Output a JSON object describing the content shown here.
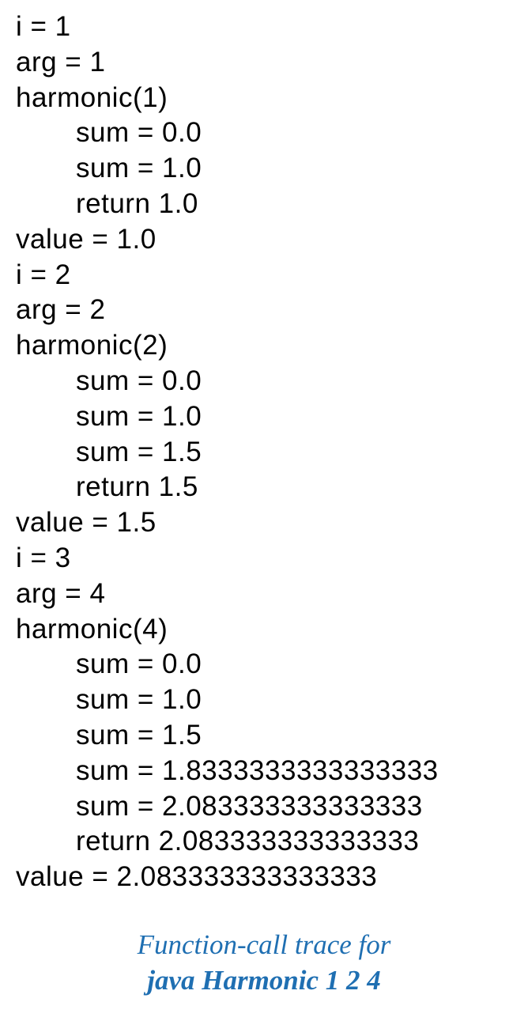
{
  "trace_lines": [
    {
      "text": "i = 1",
      "indent": false
    },
    {
      "text": "arg = 1",
      "indent": false
    },
    {
      "text": "harmonic(1)",
      "indent": false
    },
    {
      "text": "sum = 0.0",
      "indent": true
    },
    {
      "text": "sum = 1.0",
      "indent": true
    },
    {
      "text": "return 1.0",
      "indent": true
    },
    {
      "text": "value = 1.0",
      "indent": false
    },
    {
      "text": "i = 2",
      "indent": false
    },
    {
      "text": "arg = 2",
      "indent": false
    },
    {
      "text": "harmonic(2)",
      "indent": false
    },
    {
      "text": "sum = 0.0",
      "indent": true
    },
    {
      "text": "sum = 1.0",
      "indent": true
    },
    {
      "text": "sum = 1.5",
      "indent": true
    },
    {
      "text": "return 1.5",
      "indent": true
    },
    {
      "text": "value = 1.5",
      "indent": false
    },
    {
      "text": "i = 3",
      "indent": false
    },
    {
      "text": "arg = 4",
      "indent": false
    },
    {
      "text": "harmonic(4)",
      "indent": false
    },
    {
      "text": "sum = 0.0",
      "indent": true
    },
    {
      "text": "sum = 1.0",
      "indent": true
    },
    {
      "text": "sum = 1.5",
      "indent": true
    },
    {
      "text": "sum = 1.8333333333333333",
      "indent": true
    },
    {
      "text": "sum = 2.083333333333333",
      "indent": true
    },
    {
      "text": "return 2.083333333333333",
      "indent": true
    },
    {
      "text": "value = 2.083333333333333",
      "indent": false
    }
  ],
  "caption": {
    "line1": "Function-call trace for",
    "line2": "java Harmonic 1 2 4"
  }
}
